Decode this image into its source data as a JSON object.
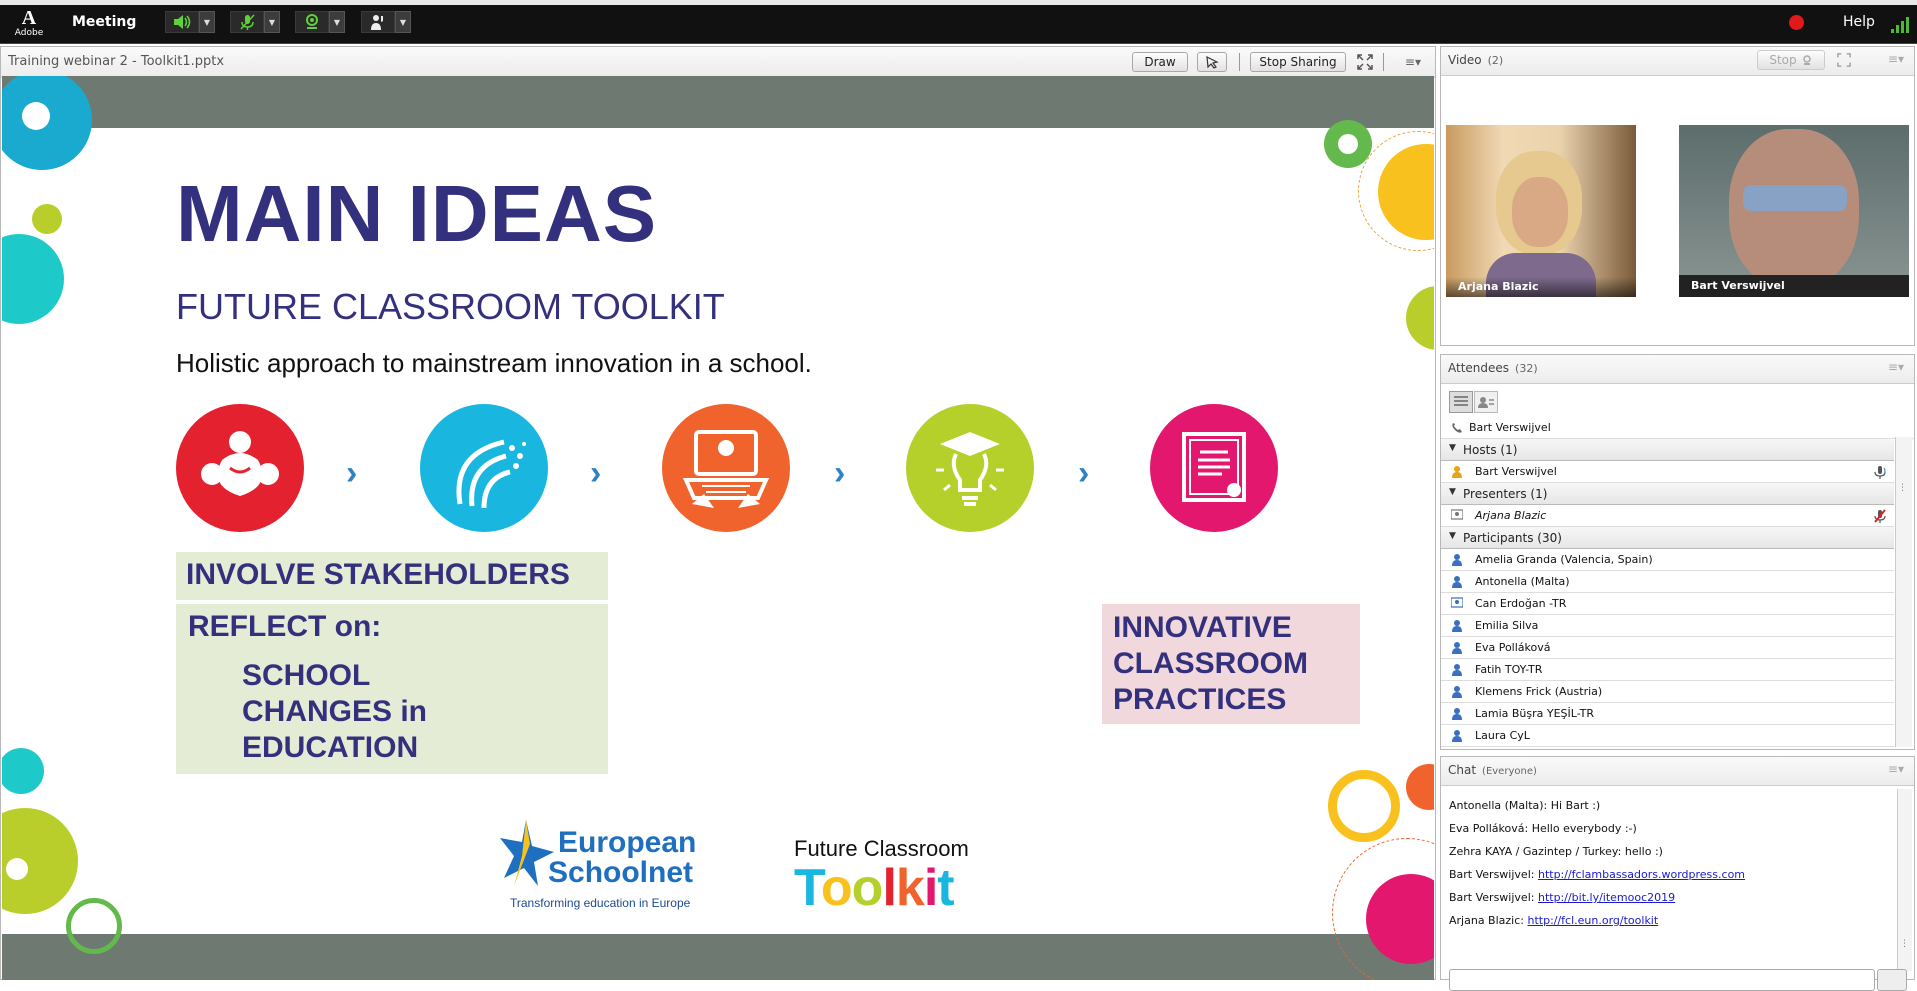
{
  "topbar": {
    "adobe_label": "Adobe",
    "meeting_menu": "Meeting",
    "help": "Help"
  },
  "share_pod": {
    "title": "Training webinar 2 - Toolkit1.pptx",
    "draw_label": "Draw",
    "stop_sharing_label": "Stop Sharing"
  },
  "slide": {
    "title": "MAIN IDEAS",
    "subtitle": "FUTURE CLASSROOM TOOLKIT",
    "lead": "Holistic approach to mainstream innovation in a school.",
    "box1": "INVOLVE STAKEHOLDERS",
    "box2_head": "REFLECT on:",
    "box2_lines": [
      "SCHOOL",
      "CHANGES in",
      "EDUCATION"
    ],
    "box3_lines": [
      "INNOVATIVE",
      "CLASSROOM",
      "PRACTICES"
    ],
    "logo1_line1": "European",
    "logo1_line2": "Schoolnet",
    "logo1_tagline": "Transforming education in Europe",
    "logo2_line1": "Future Classroom",
    "logo2_letters": [
      "T",
      "o",
      "o",
      "l",
      "k",
      "i",
      "t"
    ],
    "colors": {
      "purple": "#33307d",
      "icon_red": "#e3212f",
      "icon_cyan": "#19b6e0",
      "icon_orange": "#f0632c",
      "icon_lime": "#b5cf2b",
      "icon_pink": "#e3176e",
      "box_green": "#e4ecd6",
      "box_pink": "#f1d8dc"
    }
  },
  "video_pod": {
    "title": "Video",
    "count": "(2)",
    "stop_label": "Stop",
    "feeds": [
      {
        "name": "Arjana Blazic"
      },
      {
        "name": "Bart Verswijvel"
      }
    ]
  },
  "attendees_pod": {
    "title": "Attendees",
    "count": "(32)",
    "phone_user": "Bart Verswijvel",
    "groups": {
      "hosts": "Hosts (1)",
      "presenters": "Presenters (1)",
      "participants": "Participants (30)"
    },
    "host": "Bart Verswijvel",
    "presenter": "Arjana Blazic",
    "participants": [
      "Amelia Granda (Valencia, Spain)",
      "Antonella (Malta)",
      "Can Erdoğan -TR",
      "Emilia Silva",
      "Eva Polláková",
      "Fatih TOY-TR",
      "Klemens Frick (Austria)",
      "Lamia Büşra YEŞİL-TR",
      "Laura CyL"
    ]
  },
  "chat_pod": {
    "title": "Chat",
    "audience": "(Everyone)",
    "messages": [
      {
        "sender": "Antonella (Malta):",
        "text": "Hi Bart :)",
        "link": ""
      },
      {
        "sender": "Eva Polláková:",
        "text": "Hello everybody :-)",
        "link": ""
      },
      {
        "sender": "Zehra KAYA / Gazintep / Turkey:",
        "text": "hello :)",
        "link": ""
      },
      {
        "sender": "Bart Verswijvel:",
        "text": "",
        "link": "http://fclambassadors.wordpress.com"
      },
      {
        "sender": "Bart Verswijvel:",
        "text": "",
        "link": "http://bit.ly/itemooc2019"
      },
      {
        "sender": "Arjana Blazic:",
        "text": "",
        "link": "http://fcl.eun.org/toolkit"
      }
    ]
  }
}
